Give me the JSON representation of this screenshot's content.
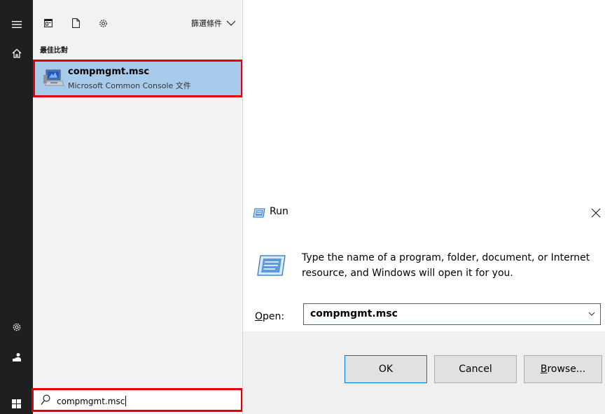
{
  "start_menu": {
    "rail": {
      "icons": [
        "hamburger-icon",
        "home-icon",
        "settings-icon",
        "user-icon",
        "windows-icon"
      ]
    },
    "toolbar": {
      "icons": [
        "apps-icon",
        "document-icon",
        "gear-icon"
      ],
      "filter_label": "篩選條件"
    },
    "section_label": "最佳比對",
    "best_match": {
      "title": "compmgmt.msc",
      "subtitle": "Microsoft Common Console 文件",
      "icon": "console-icon"
    },
    "search": {
      "value": "compmgmt.msc",
      "icon": "search-icon"
    },
    "highlight_color": "#e0000c",
    "selection_color": "#a9cbeb"
  },
  "run_dialog": {
    "title": "Run",
    "description": "Type the name of a program, folder, document, or Internet resource, and Windows will open it for you.",
    "open_label_accel": "O",
    "open_label_rest": "pen:",
    "open_value": "compmgmt.msc",
    "buttons": {
      "ok": "OK",
      "cancel": "Cancel",
      "browse_accel": "B",
      "browse_rest": "rowse..."
    },
    "accent_color": "#0078d7"
  }
}
